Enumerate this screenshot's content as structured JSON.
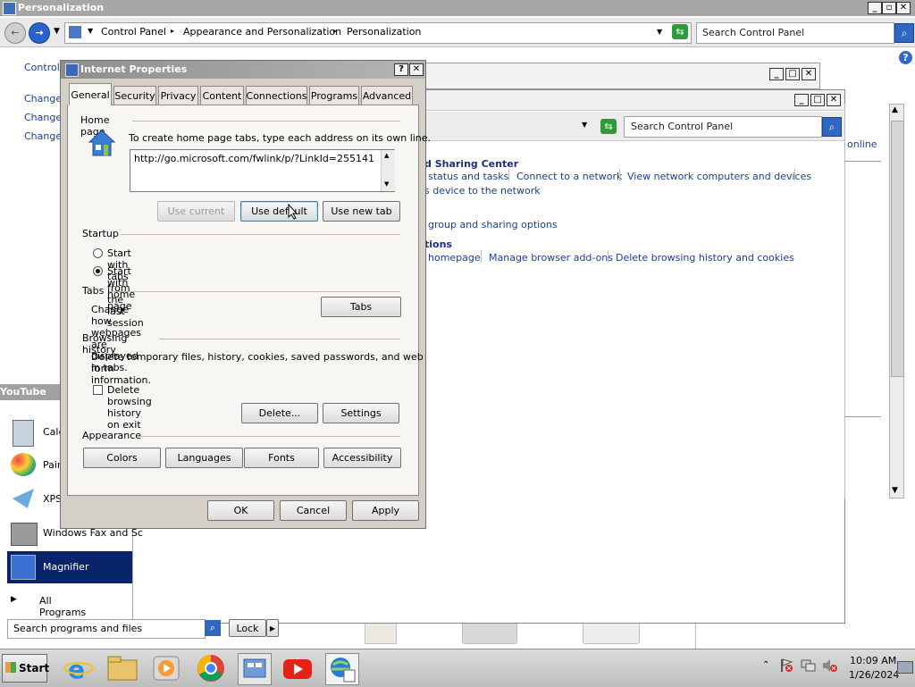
{
  "main_window": {
    "title": "Personalization",
    "breadcrumb": [
      "Control Panel",
      "Appearance and Personalization",
      "Personalization"
    ],
    "search_placeholder": "Search Control Panel",
    "left_partial": [
      "Control",
      "Change",
      "Change",
      "Change"
    ]
  },
  "network_window": {
    "search_placeholder": "Search Control Panel",
    "heading_sharing": "d Sharing Center",
    "links_row1": [
      "status and tasks",
      "Connect to a network",
      "View network computers and devices"
    ],
    "link_device": "s device to the network",
    "link_group": "group and sharing options",
    "heading_options": "tions",
    "links_row2": [
      "homepage",
      "Manage browser add-ons",
      "Delete browsing history and cookies"
    ],
    "online": "online"
  },
  "dialog": {
    "title": "Internet Properties",
    "tabs": [
      "General",
      "Security",
      "Privacy",
      "Content",
      "Connections",
      "Programs",
      "Advanced"
    ],
    "active_tab": "General",
    "home_page": {
      "label": "Home page",
      "instruction": "To create home page tabs, type each address on its own line.",
      "url": "http://go.microsoft.com/fwlink/p/?LinkId=255141",
      "use_current": "Use current",
      "use_default": "Use default",
      "use_new_tab": "Use new tab"
    },
    "startup": {
      "label": "Startup",
      "option1": "Start with tabs from the last session",
      "option2": "Start with home page",
      "selected": "Start with home page"
    },
    "tabs_section": {
      "label": "Tabs",
      "text": "Change how webpages are displayed in tabs.",
      "button": "Tabs"
    },
    "browsing_history": {
      "label": "Browsing history",
      "text_line1": "Delete temporary files, history, cookies, saved passwords, and web",
      "text_line2": "form information.",
      "checkbox": "Delete browsing history on exit",
      "checked": false,
      "delete_button": "Delete...",
      "settings_button": "Settings"
    },
    "appearance": {
      "label": "Appearance",
      "buttons": [
        "Colors",
        "Languages",
        "Fonts",
        "Accessibility"
      ]
    },
    "footer": {
      "ok": "OK",
      "cancel": "Cancel",
      "apply": "Apply"
    }
  },
  "start_menu": {
    "header": "YouTube",
    "items": [
      "Calc",
      "Pain",
      "XPS",
      "Windows Fax and Sc",
      "Magnifier"
    ],
    "all_programs": "All Programs",
    "search_placeholder": "Search programs and files",
    "lock": "Lock"
  },
  "taskbar": {
    "start": "Start",
    "apps": [
      "internet-explorer",
      "file-explorer",
      "media-player",
      "chrome",
      "control-panel",
      "youtube",
      "internet-properties"
    ],
    "time": "10:09 AM",
    "date": "1/26/2024"
  },
  "colors": {
    "title_bar": "#a0a0a0",
    "link": "#1a3e9c",
    "dialog_bg": "#d4d0c8",
    "taskbar": "#c8c8c8",
    "highlight": "#0a246a"
  }
}
